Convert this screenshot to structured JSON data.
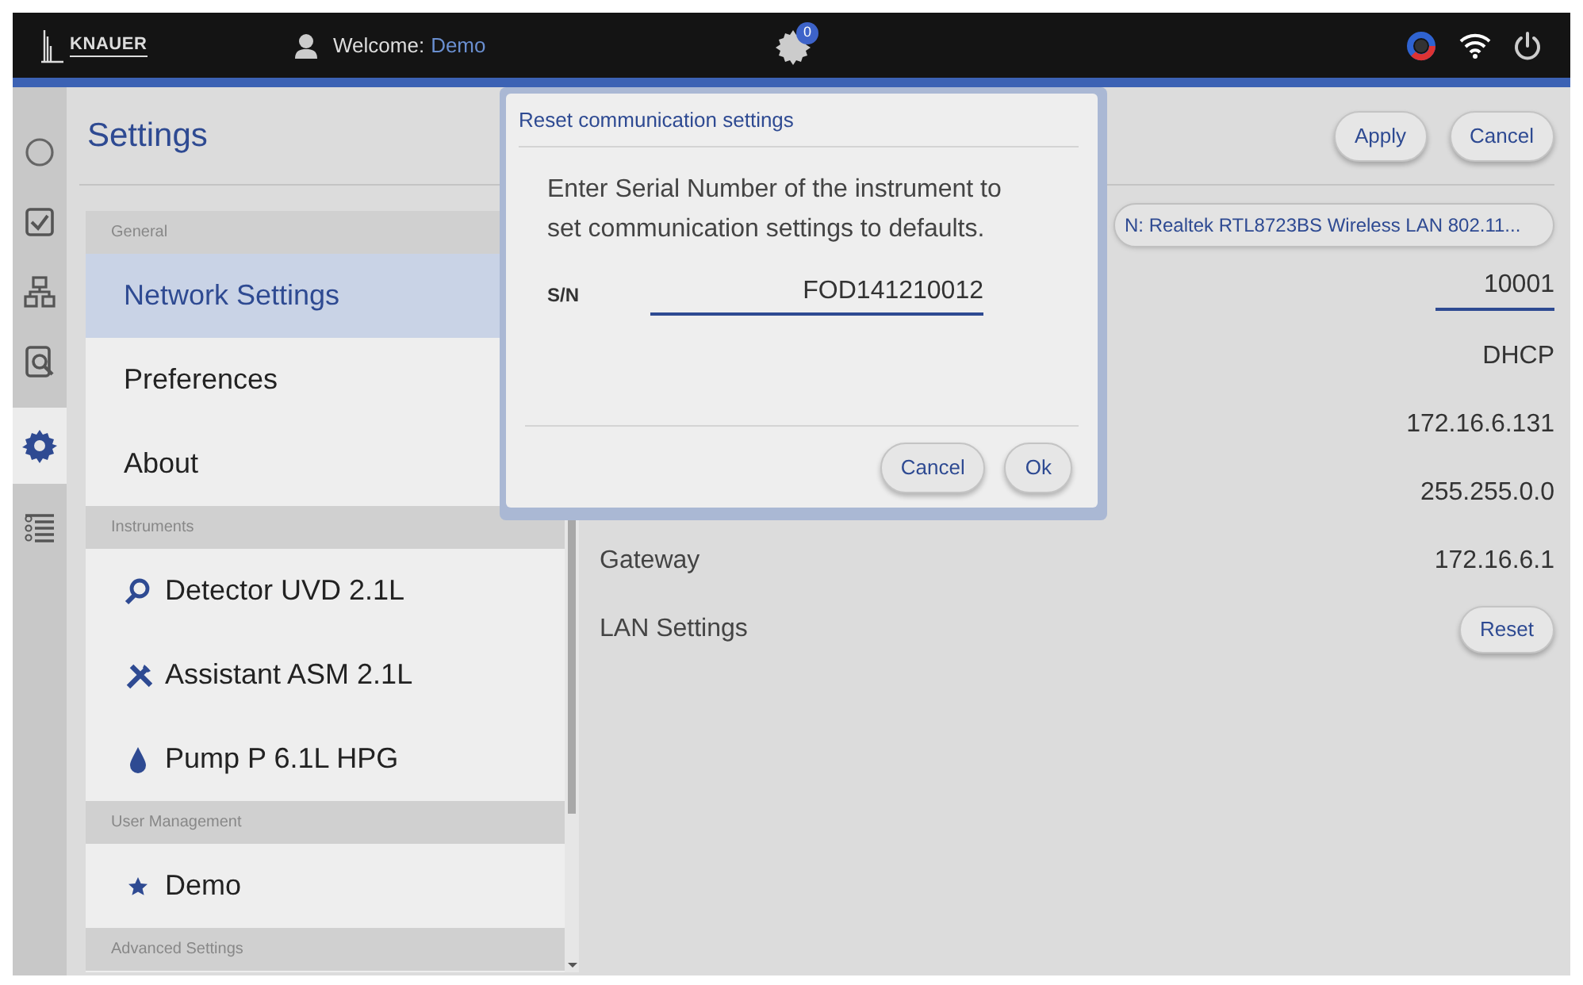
{
  "header": {
    "logo": "KNAUER",
    "welcome_label": "Welcome:",
    "user": "Demo",
    "notification_count": "0"
  },
  "rail": [
    {
      "kind": "progress",
      "selected": false
    },
    {
      "kind": "check",
      "selected": false
    },
    {
      "kind": "network",
      "selected": false
    },
    {
      "kind": "report",
      "selected": false
    },
    {
      "kind": "gear",
      "selected": true
    },
    {
      "kind": "list",
      "selected": false
    }
  ],
  "settings": {
    "title": "Settings",
    "groups": [
      {
        "title": "General",
        "items": [
          {
            "label": "Network Settings",
            "kind": "plain",
            "selected": true
          },
          {
            "label": "Preferences",
            "kind": "plain",
            "selected": false
          },
          {
            "label": "About",
            "kind": "plain",
            "selected": false
          }
        ]
      },
      {
        "title": "Instruments",
        "items": [
          {
            "label": "Detector UVD 2.1L",
            "kind": "detector",
            "selected": false
          },
          {
            "label": "Assistant ASM 2.1L",
            "kind": "assistant",
            "selected": false
          },
          {
            "label": "Pump P 6.1L HPG",
            "kind": "pump",
            "selected": false
          }
        ]
      },
      {
        "title": "User Management",
        "items": [
          {
            "label": "Demo",
            "kind": "user",
            "selected": false
          }
        ]
      },
      {
        "title": "Advanced Settings"
      }
    ]
  },
  "network": {
    "buttons": [
      "Apply",
      "Cancel"
    ],
    "adapter": "N: Realtek RTL8723BS Wireless LAN 802.11...",
    "rows": [
      {
        "kind": "field",
        "value": "10001"
      },
      {
        "kind": "value",
        "value": "DHCP"
      },
      {
        "kind": "value",
        "value": "172.16.6.131"
      },
      {
        "kind": "value",
        "value": "255.255.0.0"
      },
      {
        "kind": "value",
        "label": "Gateway",
        "value": "172.16.6.1"
      },
      {
        "kind": "button",
        "label": "LAN Settings",
        "value": "Reset"
      }
    ]
  },
  "dialog": {
    "title": "Reset communication settings",
    "message": "Enter Serial Number of the instrument to set communication settings to defaults.",
    "field_label": "S/N",
    "field_value": "FOD141210012",
    "buttons": [
      "Cancel",
      "Ok"
    ]
  }
}
